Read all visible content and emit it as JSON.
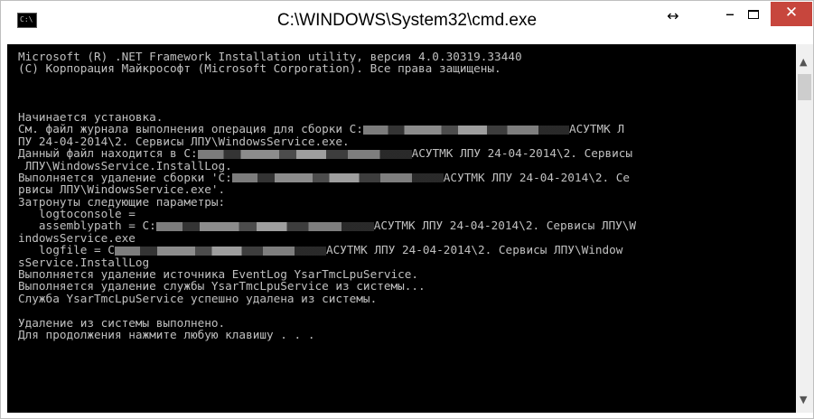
{
  "window": {
    "title": "C:\\WINDOWS\\System32\\cmd.exe",
    "app_icon_text": "C:\\",
    "controls": {
      "restore": "↔",
      "minimize": "–",
      "close": "✕"
    }
  },
  "console": {
    "lines": [
      {
        "text": "Microsoft (R) .NET Framework Installation utility, версия 4.0.30319.33440"
      },
      {
        "text": "(C) Корпорация Майкрософт (Microsoft Corporation). Все права защищены."
      },
      {
        "text": ""
      },
      {
        "text": ""
      },
      {
        "text": ""
      },
      {
        "text": "Начинается установка."
      },
      {
        "pre": "См. файл журнала выполнения операция для сборки C:",
        "blur": 228,
        "post": "АСУТМК Л"
      },
      {
        "text": "ПУ 24-04-2014\\2. Сервисы ЛПУ\\WindowsService.exe."
      },
      {
        "pre": "Данный файл находится в C:",
        "blur": 237,
        "post": "АСУТМК ЛПУ 24-04-2014\\2. Сервисы"
      },
      {
        "text": " ЛПУ\\WindowsService.InstallLog."
      },
      {
        "pre": "Выполняется удаление сборки 'C:",
        "blur": 234,
        "post": "АСУТМК ЛПУ 24-04-2014\\2. Се"
      },
      {
        "text": "рвисы ЛПУ\\WindowsService.exe'."
      },
      {
        "text": "Затронуты следующие параметры:"
      },
      {
        "text": "   logtoconsole ="
      },
      {
        "pre": "   assemblypath = C:",
        "blur": 241,
        "post": "АСУТМК ЛПУ 24-04-2014\\2. Сервисы ЛПУ\\W"
      },
      {
        "text": "indowsService.exe"
      },
      {
        "pre": "   logfile = C",
        "blur": 234,
        "post": "АСУТМК ЛПУ 24-04-2014\\2. Сервисы ЛПУ\\Window"
      },
      {
        "text": "sService.InstallLog"
      },
      {
        "text": "Выполняется удаление источника EventLog YsarTmcLpuService."
      },
      {
        "text": "Выполняется удаление службы YsarTmcLpuService из системы..."
      },
      {
        "text": "Служба YsarTmcLpuService успешно удалена из системы."
      },
      {
        "text": ""
      },
      {
        "text": "Удаление из системы выполнено."
      },
      {
        "text": "Для продолжения нажмите любую клавишу . . ."
      }
    ]
  },
  "scrollbar": {
    "up_icon": "up-arrow-icon",
    "down_icon": "down-arrow-icon"
  }
}
